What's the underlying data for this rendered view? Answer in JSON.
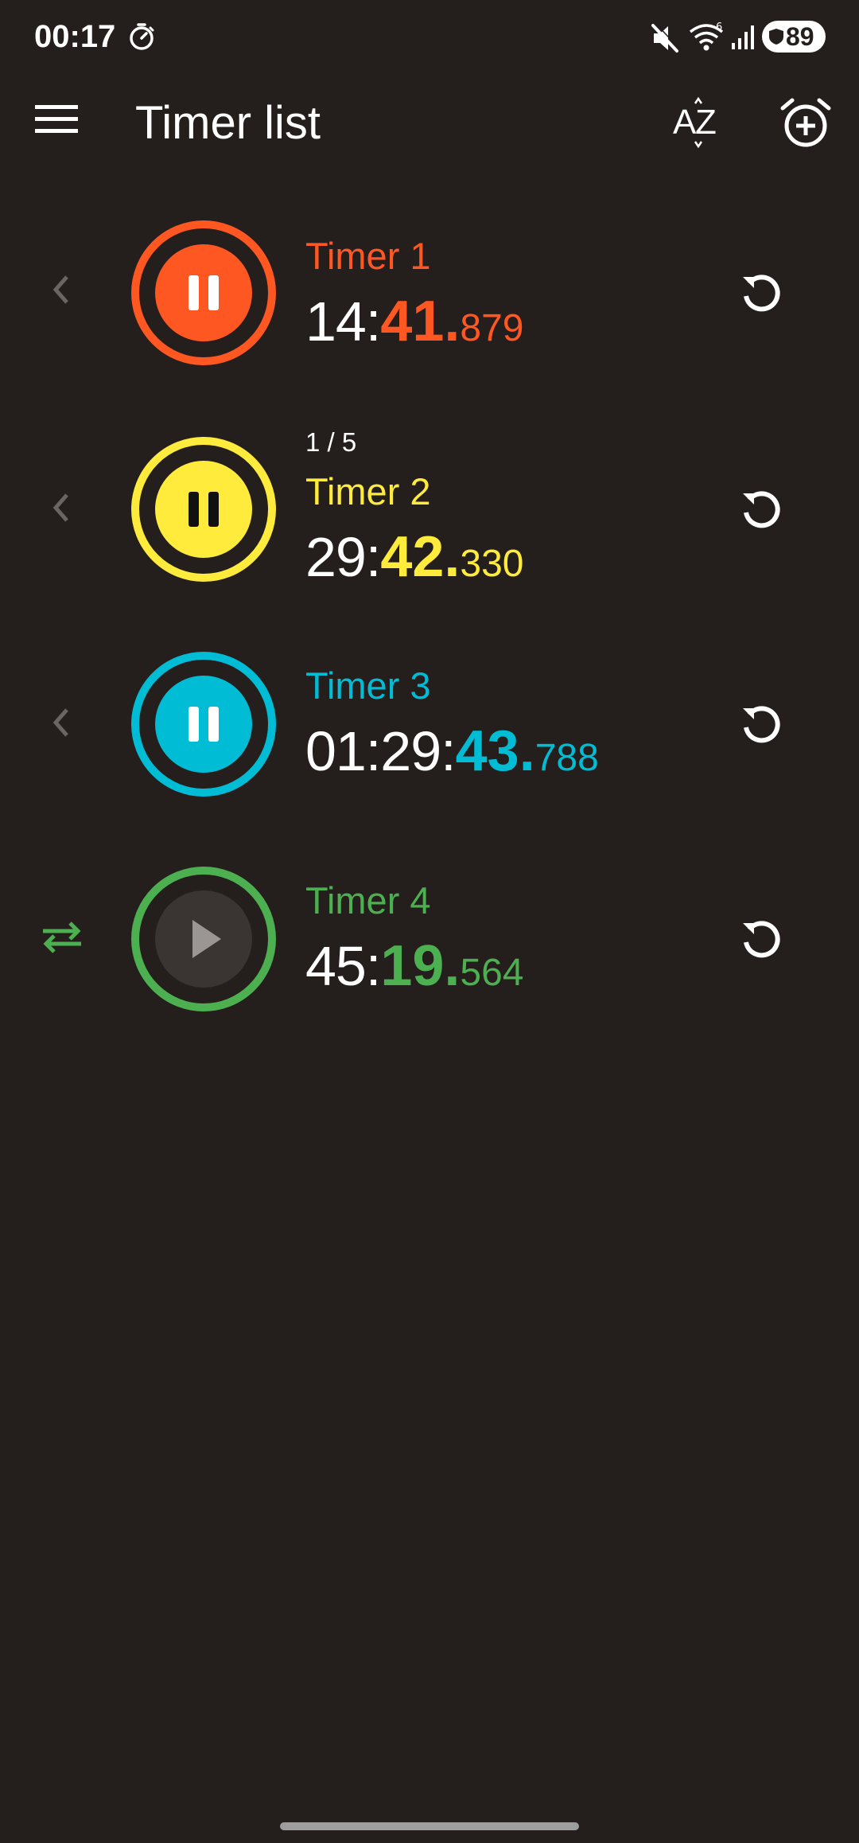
{
  "status_bar": {
    "time": "00:17",
    "battery": "89"
  },
  "app_bar": {
    "title": "Timer list",
    "icons": [
      "menu-icon",
      "sort-az-icon",
      "add-alarm-icon"
    ]
  },
  "colors": {
    "background": "#241e1c",
    "timer1": "#ff5722",
    "timer2": "#ffeb3b",
    "timer3": "#00bcd4",
    "timer4": "#4caf50"
  },
  "timers": [
    {
      "name": "Timer 1",
      "subtitle": "",
      "time_main": "14:",
      "time_sec": "41.",
      "time_ms": "879",
      "state": "running",
      "left_icon": "chevron-left-icon"
    },
    {
      "name": "Timer 2",
      "subtitle": "1 / 5",
      "time_main": "29:",
      "time_sec": "42.",
      "time_ms": "330",
      "state": "running",
      "left_icon": "chevron-left-icon"
    },
    {
      "name": "Timer 3",
      "subtitle": "",
      "time_main": "01:29:",
      "time_sec": "43.",
      "time_ms": "788",
      "state": "running",
      "left_icon": "chevron-left-icon"
    },
    {
      "name": "Timer 4",
      "subtitle": "",
      "time_main": "45:",
      "time_sec": "19.",
      "time_ms": "564",
      "state": "paused",
      "left_icon": "swap-arrows-icon"
    }
  ]
}
